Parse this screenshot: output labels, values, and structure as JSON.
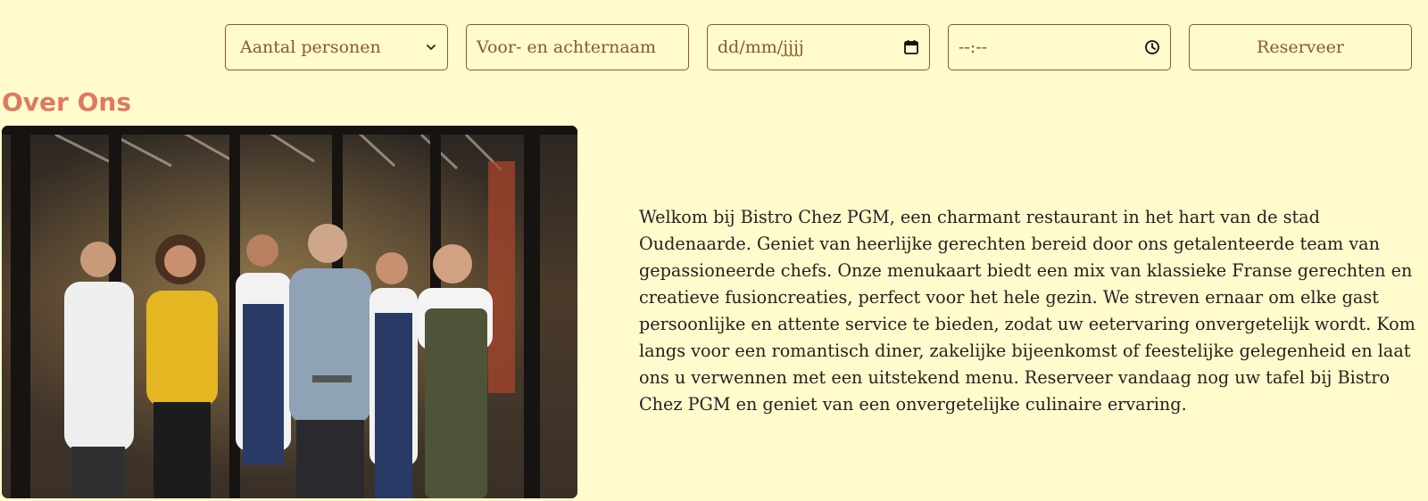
{
  "reservation": {
    "persons_select": {
      "value": "Aantal personen"
    },
    "name_input": {
      "placeholder": "Voor- en achternaam"
    },
    "date_input": {
      "placeholder": "dd/mm/jjjj",
      "icon": "calendar-icon"
    },
    "time_input": {
      "placeholder": "--:--",
      "icon": "clock-icon"
    },
    "submit_label": "Reserveer"
  },
  "about": {
    "title": "Over Ons",
    "image_alt": "Team van Bistro Chez PGM",
    "text": "Welkom bij Bistro Chez PGM, een charmant restaurant in het hart van de stad Oudenaarde. Geniet van heerlijke gerechten bereid door ons getalenteerde team van gepassioneerde chefs. Onze menukaart biedt een mix van klassieke Franse gerechten en creatieve fusioncreaties, perfect voor het hele gezin. We streven ernaar om elke gast persoonlijke en attente service te bieden, zodat uw eetervaring onvergetelijk wordt. Kom langs voor een romantisch diner, zakelijke bijeenkomst of feestelijke gelegenheid en laat ons u verwennen met een uitstekend menu. Reserveer vandaag nog uw tafel bij Bistro Chez PGM en geniet van een onvergetelijke culinaire ervaring."
  },
  "colors": {
    "background": "#fffbcc",
    "accent_brown": "#8b5a2b",
    "heading": "#e07860"
  }
}
